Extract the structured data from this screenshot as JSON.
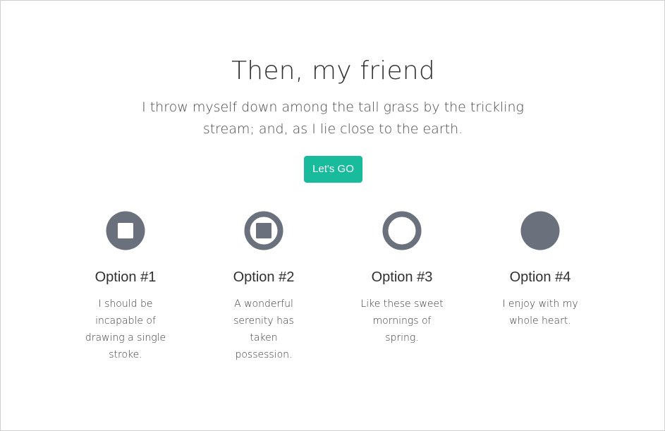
{
  "hero": {
    "title": "Then, my friend",
    "lead": "I throw myself down among the tall grass by the trickling stream; and, as I lie close to the earth.",
    "cta_label": "Let's GO"
  },
  "features": [
    {
      "icon": "stop-circle-icon",
      "title": "Option #1",
      "text": "I should be incapable of drawing a single stroke."
    },
    {
      "icon": "stop-circle-outline-icon",
      "title": "Option #2",
      "text": "A wonderful serenity has taken possession."
    },
    {
      "icon": "circle-outline-icon",
      "title": "Option #3",
      "text": "Like these sweet mornings of spring."
    },
    {
      "icon": "circle-filled-icon",
      "title": "Option #4",
      "text": "I enjoy with my whole heart."
    }
  ],
  "colors": {
    "accent": "#18bc9c",
    "icon": "#6a717d",
    "text": "#2f2f2f",
    "border": "#cfcfcf"
  }
}
